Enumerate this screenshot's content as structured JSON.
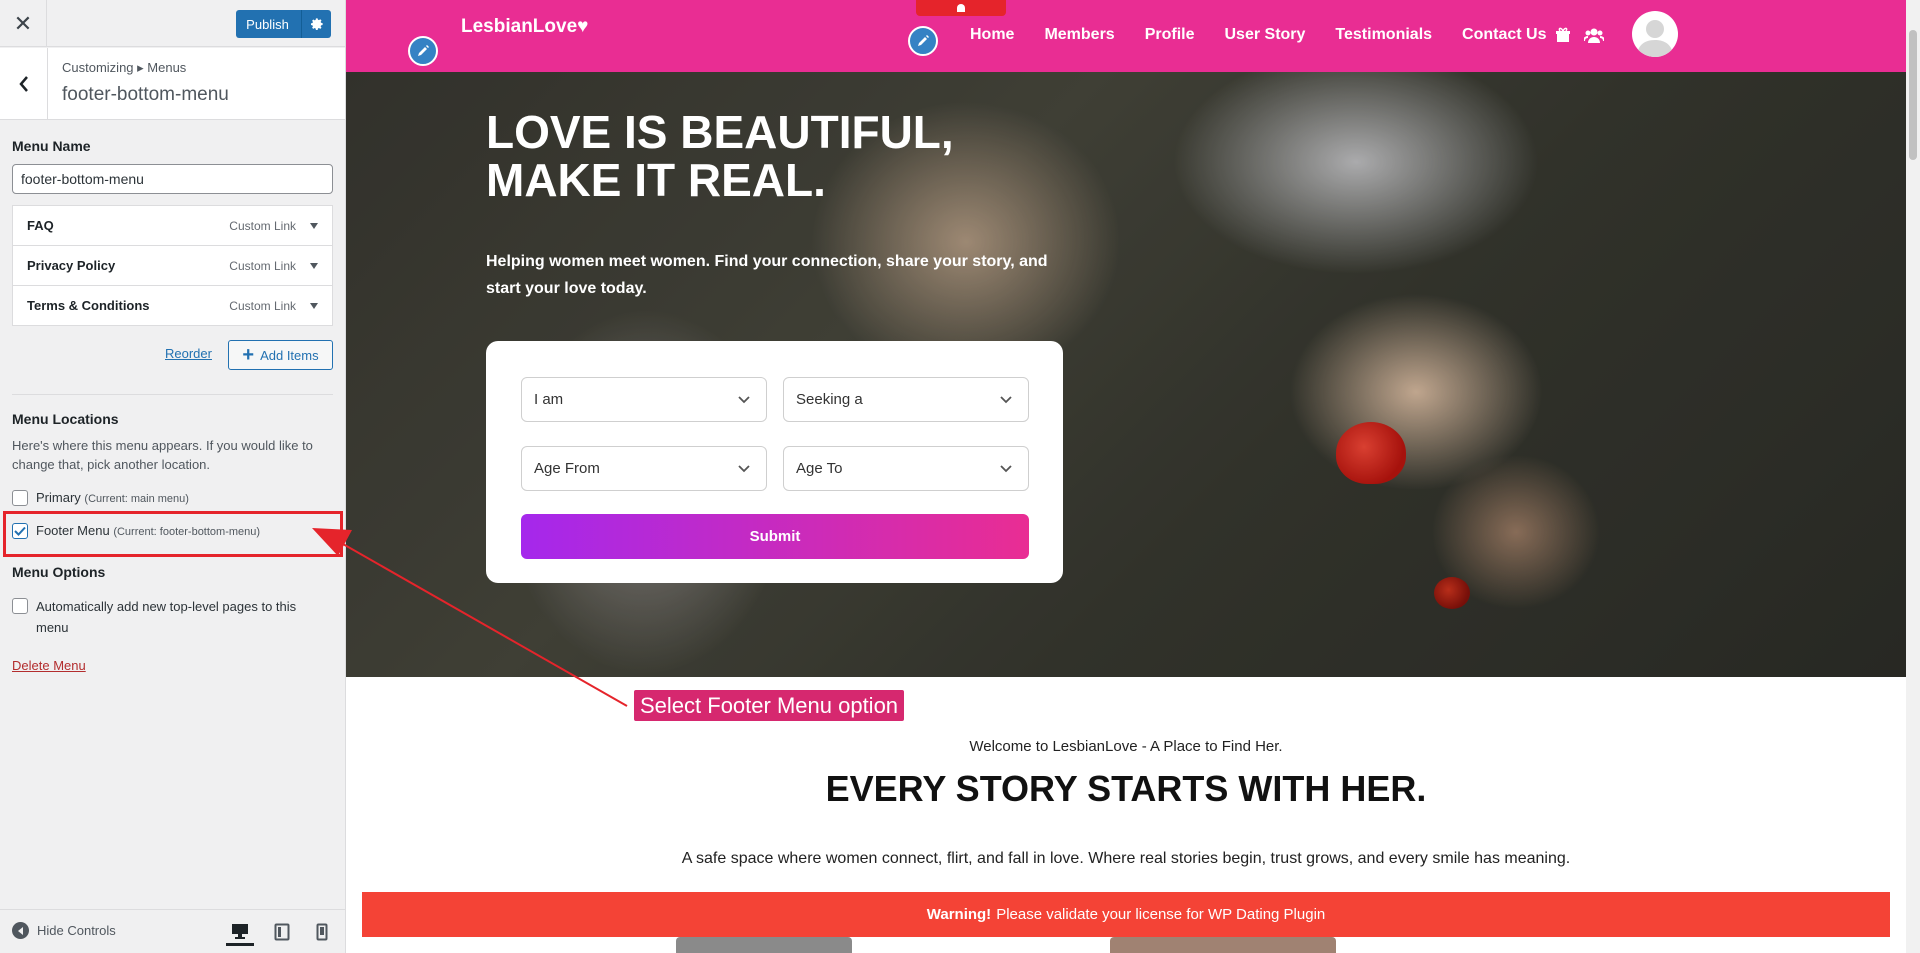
{
  "customizer": {
    "publish_label": "Publish",
    "breadcrumb": "Customizing ▸ Menus",
    "section_title": "footer-bottom-menu",
    "menu_name_label": "Menu Name",
    "menu_name_value": "footer-bottom-menu",
    "menu_items": [
      {
        "title": "FAQ",
        "type": "Custom Link"
      },
      {
        "title": "Privacy Policy",
        "type": "Custom Link"
      },
      {
        "title": "Terms & Conditions",
        "type": "Custom Link"
      }
    ],
    "reorder_label": "Reorder",
    "add_items_label": "Add Items",
    "locations_heading": "Menu Locations",
    "locations_desc": "Here's where this menu appears. If you would like to change that, pick another location.",
    "locations": [
      {
        "label": "Primary",
        "current": "(Current: main menu)",
        "checked": false
      },
      {
        "label": "Footer Menu",
        "current": "(Current: footer-bottom-menu)",
        "checked": true
      }
    ],
    "options_heading": "Menu Options",
    "auto_add_label": "Automatically add new top-level pages to this menu",
    "delete_label": "Delete Menu",
    "hide_controls_label": "Hide Controls"
  },
  "site": {
    "brand": "LesbianLove♥",
    "nav": [
      "Home",
      "Members",
      "Profile",
      "User Story",
      "Testimonials",
      "Contact Us"
    ],
    "hero_title": "LOVE IS BEAUTIFUL, MAKE IT REAL.",
    "hero_subtitle": "Helping women meet women. Find your connection, share your story, and start your love today.",
    "form": {
      "i_am": "I am",
      "seeking": "Seeking a",
      "age_from": "Age From",
      "age_to": "Age To",
      "submit": "Submit"
    },
    "welcome": "Welcome to LesbianLove - A Place to Find Her.",
    "headline": "EVERY STORY STARTS WITH HER.",
    "tagline": "A safe space where women connect, flirt, and fall in love. Where real stories begin, trust grows, and every smile has meaning.",
    "warning_bold": "Warning!",
    "warning_text": "Please validate your license for WP Dating Plugin"
  },
  "annotation": {
    "label": "Select Footer Menu option"
  },
  "colors": {
    "wp_blue": "#2271b1",
    "brand_pink": "#e92d93",
    "warning_red": "#f44336",
    "highlight_red": "#e5242b"
  }
}
